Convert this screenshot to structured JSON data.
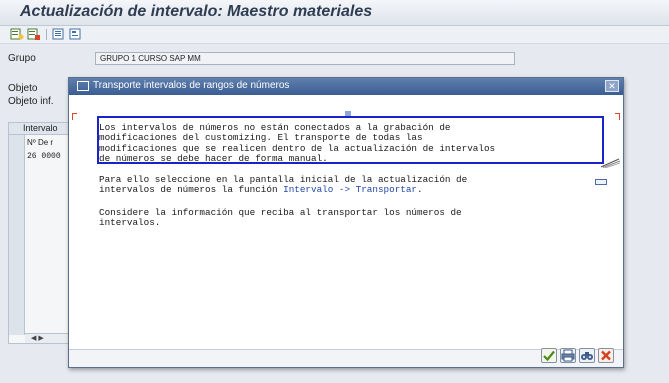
{
  "window": {
    "title": "Actualización de intervalo: Maestro materiales"
  },
  "toolbar": {
    "icons": [
      "create-interval-icon",
      "change-interval-icon",
      "display-icon",
      "overview-icon"
    ]
  },
  "form": {
    "grupo_label": "Grupo",
    "grupo_value": "GRUPO 1 CURSO SAP MM",
    "objeto_label": "Objeto",
    "objeto_inf_label": "Objeto inf."
  },
  "table": {
    "header": "Intervalo",
    "col_no": "Nº",
    "col_de": "De r",
    "row_no": "26",
    "row_de": "0000",
    "scroll_text": "◀ ▶"
  },
  "dialog": {
    "title": "Transporte intervalos de rangos de números",
    "close_label": "✕",
    "paragraph1": "Los intervalos de números no están conectados a la grabación de\nmodificaciones del customizing. El transporte de todas las\nmodificaciones que se realicen dentro de la actualización de intervalos\nde números se debe hacer de forma manual.",
    "paragraph2_before": "Para ello seleccione en la pantalla inicial de la actualización de\nintervalos de números la función ",
    "paragraph2_link": "Intervalo -> Transportar",
    "paragraph2_after": ".",
    "paragraph3": "Considere la información que reciba al transportar los números de\nintervalos."
  },
  "footer": {
    "buttons": [
      "check-icon",
      "print-icon",
      "find-icon",
      "cancel-icon"
    ]
  },
  "colors": {
    "highlight_border": "#1a23c8",
    "dialog_title_bg": "#3a5d92",
    "link": "#2047a8"
  }
}
